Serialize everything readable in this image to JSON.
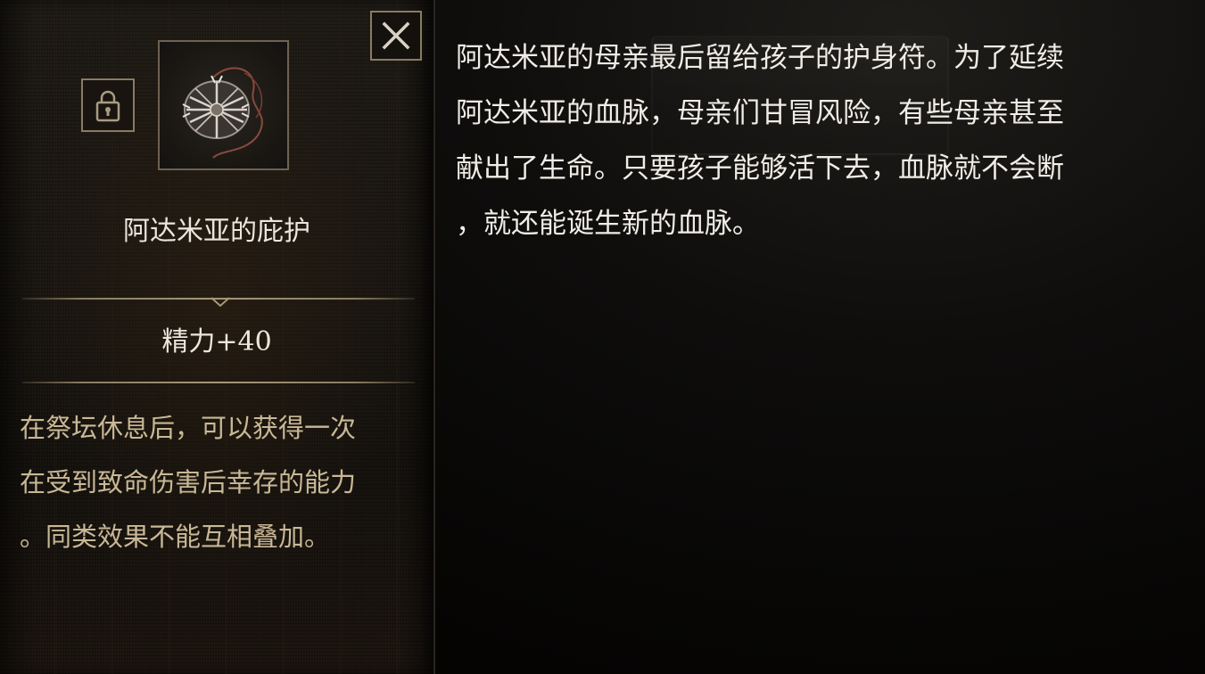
{
  "item_panel": {
    "name": "阿达米亚的庇护",
    "stat": "精力+40",
    "effect_lines": [
      "在祭坛休息后，可以获得一次",
      "在受到致命伤害后幸存的能力",
      "。同类效果不能互相叠加。"
    ],
    "icons": {
      "close": "close-icon",
      "lock": "lock-icon",
      "item": "amulet-icon"
    },
    "colors": {
      "frame_border": "#8a7c62",
      "name_text": "#ebe6dc",
      "effect_text": "#c9b896"
    }
  },
  "lore": {
    "lines": [
      "阿达米亚的母亲最后留给孩子的护身符。为了延续",
      "阿达米亚的血脉，母亲们甘冒风险，有些母亲甚至",
      "献出了生命。只要孩子能够活下去，血脉就不会断",
      "，就还能诞生新的血脉。"
    ],
    "color": "#f0ece6"
  }
}
